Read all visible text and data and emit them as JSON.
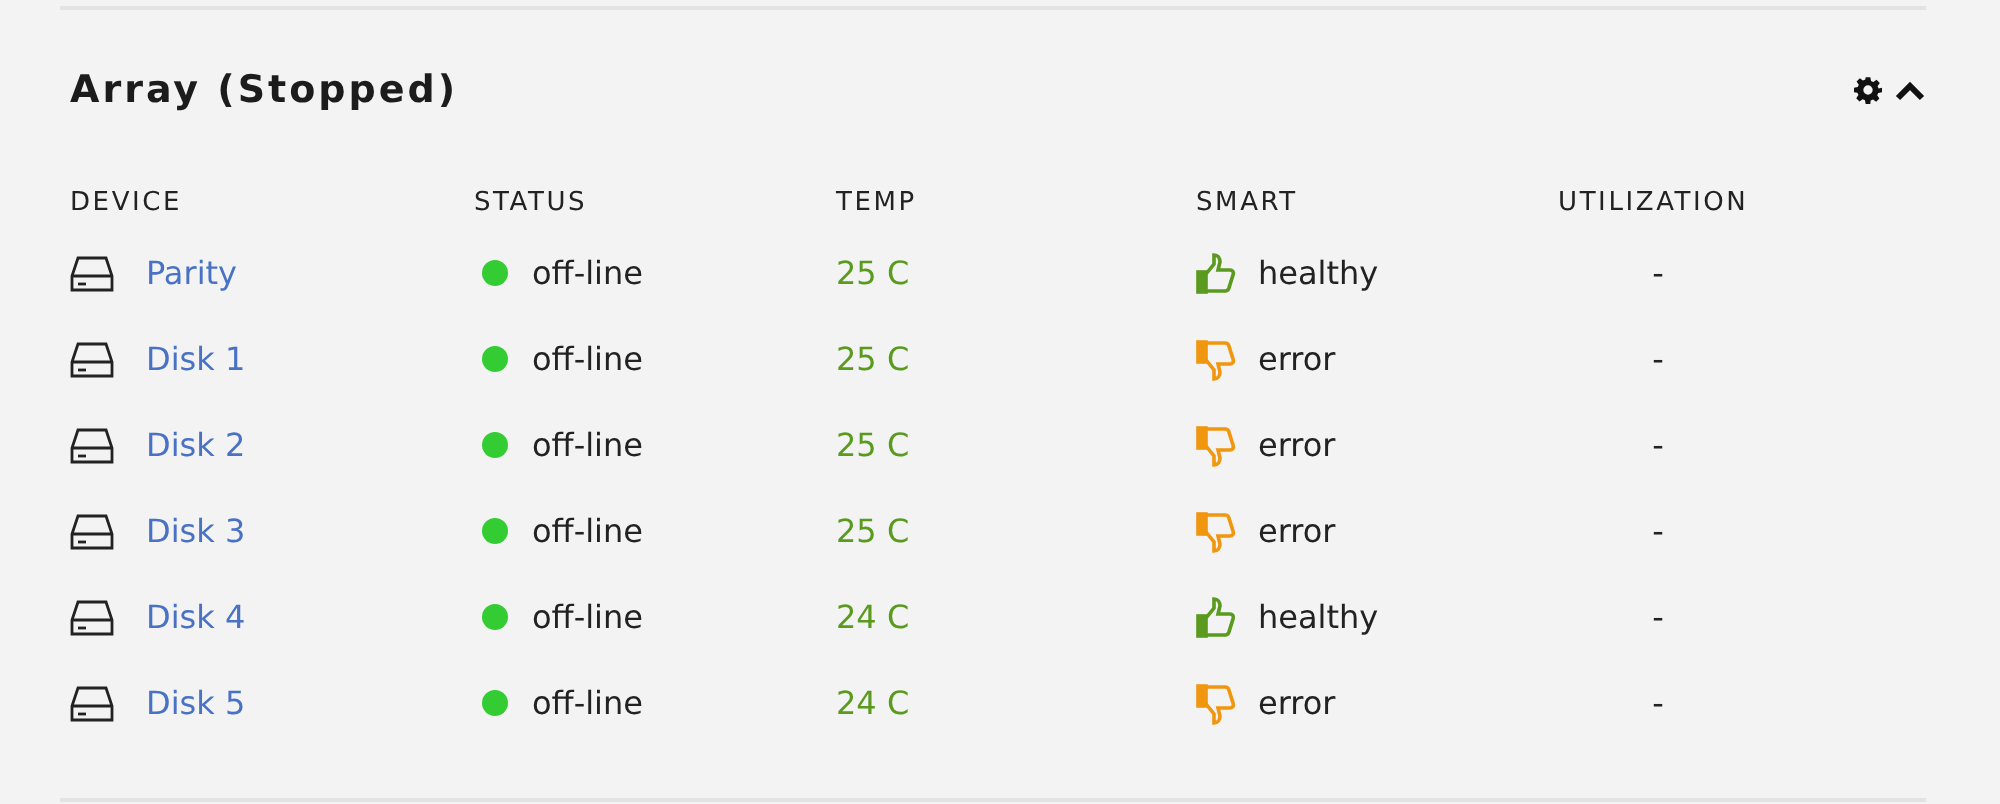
{
  "panel": {
    "title": "Array (Stopped)",
    "expanded": true
  },
  "table": {
    "columns": [
      "DEVICE",
      "STATUS",
      "TEMP",
      "SMART",
      "UTILIZATION"
    ],
    "rows": [
      {
        "device": "Parity",
        "status": {
          "text": "off-line",
          "color": "#33cc33"
        },
        "temp": "25 C",
        "smart": {
          "kind": "good",
          "text": "healthy"
        },
        "utilization": "-"
      },
      {
        "device": "Disk 1",
        "status": {
          "text": "off-line",
          "color": "#33cc33"
        },
        "temp": "25 C",
        "smart": {
          "kind": "bad",
          "text": "error"
        },
        "utilization": "-"
      },
      {
        "device": "Disk 2",
        "status": {
          "text": "off-line",
          "color": "#33cc33"
        },
        "temp": "25 C",
        "smart": {
          "kind": "bad",
          "text": "error"
        },
        "utilization": "-"
      },
      {
        "device": "Disk 3",
        "status": {
          "text": "off-line",
          "color": "#33cc33"
        },
        "temp": "25 C",
        "smart": {
          "kind": "bad",
          "text": "error"
        },
        "utilization": "-"
      },
      {
        "device": "Disk 4",
        "status": {
          "text": "off-line",
          "color": "#33cc33"
        },
        "temp": "24 C",
        "smart": {
          "kind": "good",
          "text": "healthy"
        },
        "utilization": "-"
      },
      {
        "device": "Disk 5",
        "status": {
          "text": "off-line",
          "color": "#33cc33"
        },
        "temp": "24 C",
        "smart": {
          "kind": "bad",
          "text": "error"
        },
        "utilization": "-"
      }
    ]
  }
}
